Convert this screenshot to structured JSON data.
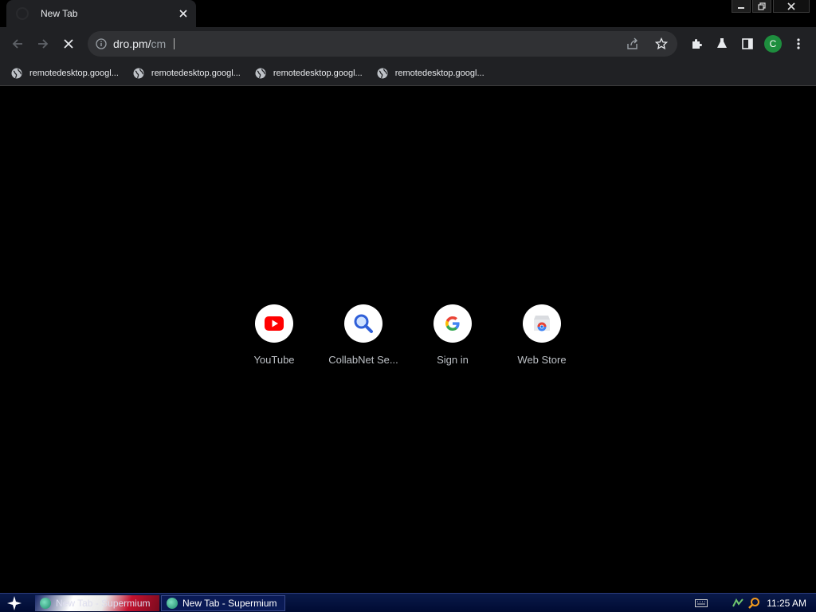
{
  "browser": {
    "tab": {
      "title": "New Tab"
    },
    "omnibox": {
      "url_typed": "dro.pm/",
      "url_suggest": "cm"
    },
    "bookmarks": [
      {
        "label": "remotedesktop.googl..."
      },
      {
        "label": "remotedesktop.googl..."
      },
      {
        "label": "remotedesktop.googl..."
      },
      {
        "label": "remotedesktop.googl..."
      }
    ],
    "profile_initial": "C"
  },
  "shortcuts": [
    {
      "label": "YouTube",
      "icon": "youtube-icon"
    },
    {
      "label": "CollabNet Se...",
      "icon": "magnifier-icon"
    },
    {
      "label": "Sign in",
      "icon": "google-g-icon"
    },
    {
      "label": "Web Store",
      "icon": "web-store-icon"
    }
  ],
  "taskbar": {
    "tasks": [
      {
        "label": "New Tab - Supermium"
      },
      {
        "label": "New Tab - Supermium"
      }
    ],
    "clock": "11:25 AM"
  },
  "colors": {
    "accent": "#1e8e3e",
    "toolbar": "#202124",
    "omnibox": "#303134"
  }
}
